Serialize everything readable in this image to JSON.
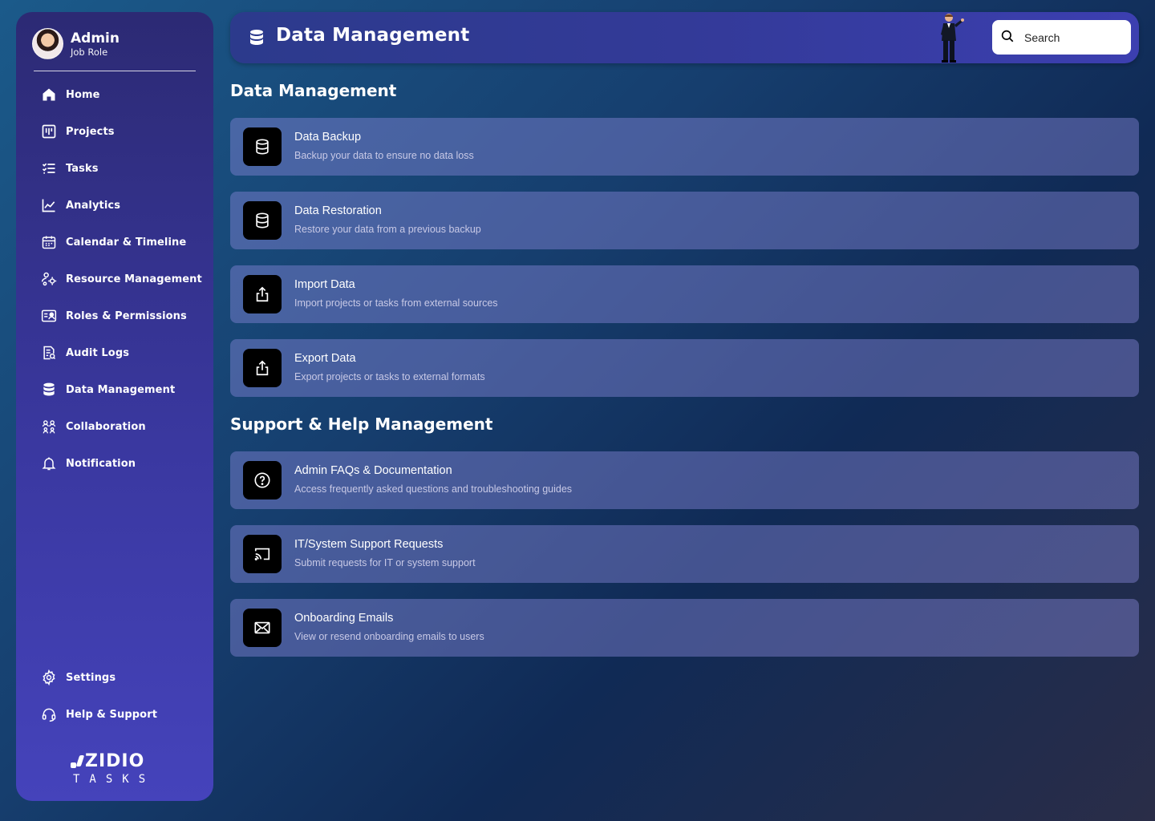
{
  "profile": {
    "name": "Admin",
    "role": "Job Role"
  },
  "sidebar": {
    "items": [
      {
        "label": "Home",
        "icon": "home-icon"
      },
      {
        "label": "Projects",
        "icon": "projects-icon"
      },
      {
        "label": "Tasks",
        "icon": "tasks-icon"
      },
      {
        "label": "Analytics",
        "icon": "analytics-icon"
      },
      {
        "label": "Calendar & Timeline",
        "icon": "calendar-icon"
      },
      {
        "label": "Resource Management",
        "icon": "resource-icon"
      },
      {
        "label": "Roles & Permissions",
        "icon": "roles-icon"
      },
      {
        "label": "Audit Logs",
        "icon": "audit-icon"
      },
      {
        "label": "Data Management",
        "icon": "database-icon"
      },
      {
        "label": "Collaboration",
        "icon": "collaboration-icon"
      },
      {
        "label": "Notification",
        "icon": "bell-icon"
      }
    ],
    "bottom_items": [
      {
        "label": "Settings",
        "icon": "gear-icon"
      },
      {
        "label": "Help & Support",
        "icon": "headset-icon"
      }
    ]
  },
  "brand": {
    "top": "ZIDIO",
    "bottom": "TASKS"
  },
  "header": {
    "title": "Data Management",
    "search_placeholder": "Search"
  },
  "sections": [
    {
      "title": "Data Management",
      "cards": [
        {
          "title": "Data Backup",
          "desc": "Backup your data to ensure no data loss",
          "icon": "database-icon"
        },
        {
          "title": "Data Restoration",
          "desc": "Restore your data from a previous backup",
          "icon": "database-icon"
        },
        {
          "title": "Import Data",
          "desc": "Import projects or tasks from external sources",
          "icon": "upload-icon"
        },
        {
          "title": "Export Data",
          "desc": "Export projects or tasks to external formats",
          "icon": "upload-icon"
        }
      ]
    },
    {
      "title": "Support & Help Management",
      "cards": [
        {
          "title": "Admin FAQs & Documentation",
          "desc": "Access frequently asked questions and troubleshooting guides",
          "icon": "question-icon"
        },
        {
          "title": "IT/System Support Requests",
          "desc": "Submit requests for IT or system support",
          "icon": "cast-icon"
        },
        {
          "title": "Onboarding Emails",
          "desc": "View or resend onboarding emails to users",
          "icon": "mail-icon"
        }
      ]
    }
  ]
}
